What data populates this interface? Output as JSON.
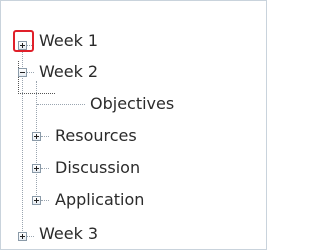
{
  "tree": {
    "items": [
      {
        "label": "Week 1",
        "toggle": "expand"
      },
      {
        "label": "Week 2",
        "toggle": "collapse"
      },
      {
        "label": "Objectives",
        "toggle": "none"
      },
      {
        "label": "Resources",
        "toggle": "expand"
      },
      {
        "label": "Discussion",
        "toggle": "expand"
      },
      {
        "label": "Application",
        "toggle": "expand"
      },
      {
        "label": "Week 3",
        "toggle": "expand"
      }
    ]
  },
  "colors": {
    "highlight": "#e0202a",
    "border": "#c9d3dc",
    "text": "#2b2b2b"
  }
}
